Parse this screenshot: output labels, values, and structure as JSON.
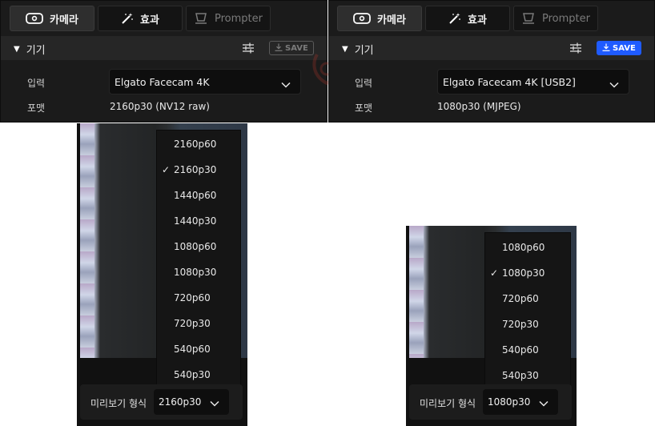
{
  "left": {
    "tabs": [
      {
        "label": "카메라",
        "icon": "camera-icon",
        "active": true
      },
      {
        "label": "효과",
        "icon": "magic-wand-icon",
        "active": false
      },
      {
        "label": "Prompter",
        "icon": "prompter-icon",
        "disabled": true
      }
    ],
    "section_title": "기기",
    "save_label": "SAVE",
    "save_enabled": false,
    "input_label": "입력",
    "input_value": "Elgato Facecam 4K",
    "format_label": "포맷",
    "format_value": "2160p30 (NV12 raw)"
  },
  "right": {
    "tabs": [
      {
        "label": "카메라",
        "icon": "camera-icon",
        "active": true
      },
      {
        "label": "효과",
        "icon": "magic-wand-icon",
        "active": false
      },
      {
        "label": "Prompter",
        "icon": "prompter-icon",
        "disabled": true
      }
    ],
    "section_title": "기기",
    "save_label": "SAVE",
    "save_enabled": true,
    "input_label": "입력",
    "input_value": "Elgato Facecam 4K [USB2]",
    "format_label": "포맷",
    "format_value": "1080p30 (MJPEG)"
  },
  "left_dropdown": {
    "options": [
      "2160p60",
      "2160p30",
      "1440p60",
      "1440p30",
      "1080p60",
      "1080p30",
      "720p60",
      "720p30",
      "540p60",
      "540p30"
    ],
    "selected": "2160p30",
    "preview_format_label": "미리보기 형식",
    "preview_format_value": "2160p30"
  },
  "right_dropdown": {
    "options": [
      "1080p60",
      "1080p30",
      "720p60",
      "720p30",
      "540p60",
      "540p30"
    ],
    "selected": "1080p30",
    "preview_format_label": "미리보기 형식",
    "preview_format_value": "1080p30"
  },
  "colors": {
    "save_active": "#1f5bff",
    "panel_bg": "#1b1b1b",
    "menu_bg": "#151515"
  }
}
